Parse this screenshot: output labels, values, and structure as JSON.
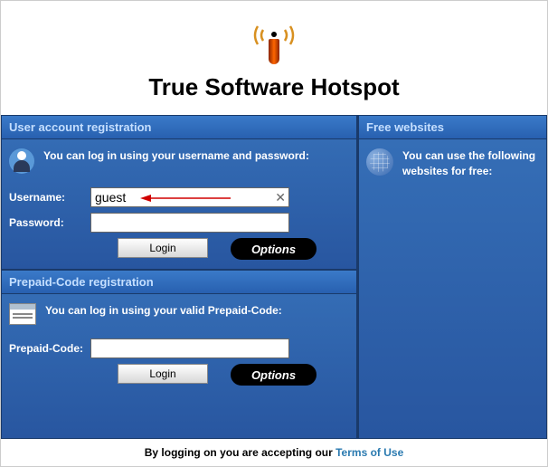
{
  "header": {
    "title": "True Software Hotspot"
  },
  "user_registration": {
    "panel_title": "User account registration",
    "info": "You can log in using your username and password:",
    "username_label": "Username:",
    "username_value": "guest",
    "password_label": "Password:",
    "password_value": "",
    "login_label": "Login",
    "options_label": "Options"
  },
  "prepaid": {
    "panel_title": "Prepaid-Code registration",
    "info": "You can log in using your valid Prepaid-Code:",
    "code_label": "Prepaid-Code:",
    "code_value": "",
    "login_label": "Login",
    "options_label": "Options"
  },
  "free_websites": {
    "panel_title": "Free websites",
    "info": "You can use the following websites for free:"
  },
  "footer": {
    "text": "By logging on you are accepting our ",
    "link": "Terms of Use"
  }
}
